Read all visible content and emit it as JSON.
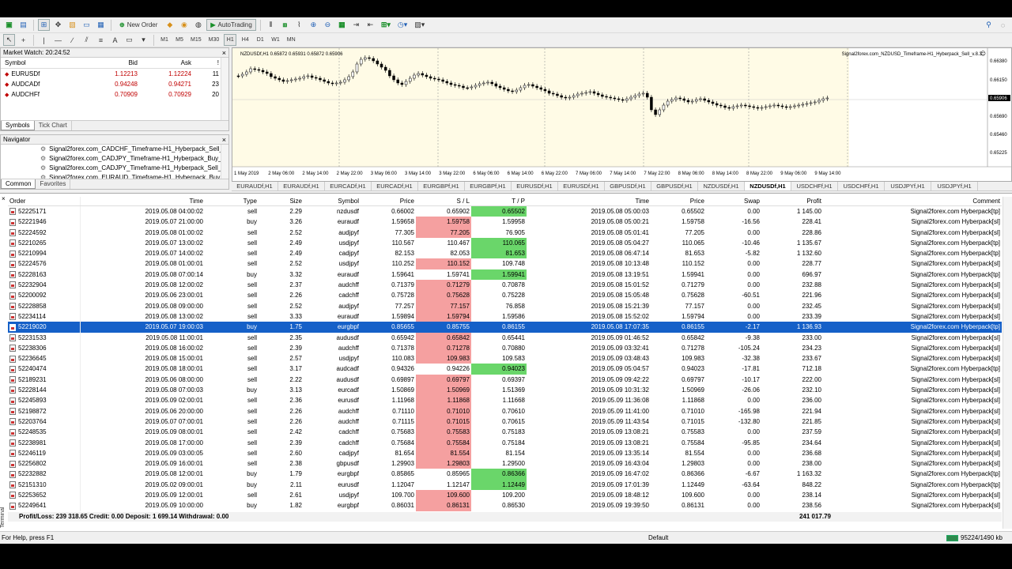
{
  "toolbar": {
    "new_order": "New Order",
    "autotrading": "AutoTrading",
    "timeframes": [
      "M1",
      "M5",
      "M15",
      "M30",
      "H1",
      "H4",
      "D1",
      "W1",
      "MN"
    ],
    "active_timeframe": "H1"
  },
  "market_watch": {
    "title": "Market Watch: 20:24:52",
    "columns": [
      "Symbol",
      "Bid",
      "Ask",
      "!"
    ],
    "rows": [
      {
        "symbol": "EURUSDf",
        "bid": "1.12213",
        "ask": "1.12224",
        "spread": "11"
      },
      {
        "symbol": "AUDCADf",
        "bid": "0.94248",
        "ask": "0.94271",
        "spread": "23"
      },
      {
        "symbol": "AUDCHFf",
        "bid": "0.70909",
        "ask": "0.70929",
        "spread": "20"
      }
    ],
    "tabs": [
      "Symbols",
      "Tick Chart"
    ]
  },
  "navigator": {
    "title": "Navigator",
    "items": [
      "Signal2forex.com_CADCHF_Timeframe-H1_Hyberpack_Sell_v.",
      "Signal2forex.com_CADJPY_Timeframe-H1_Hyberpack_Buy_v.",
      "Signal2forex.com_CADJPY_Timeframe-H1_Hyberpack_Sell_v.",
      "Signal2forex.com_EURAUD_Timeframe-H1_Hyberpack_Buy_v."
    ],
    "tabs": [
      "Common",
      "Favorites"
    ]
  },
  "chart": {
    "symbol_info": "NZDUSDf,H1  0.65872 0.65931 0.65872 0.65906",
    "ea_label": "Signal2forex.com_NZDUSD_Timeframe-H1_Hyberpack_Sell_v.8.3",
    "price_labels": [
      "0.66380",
      "0.66150",
      "0.65906",
      "0.65690",
      "0.65460",
      "0.65225"
    ],
    "current_price": "0.65906",
    "time_labels": [
      "1 May 2019",
      "2 May 06:00",
      "2 May 14:00",
      "2 May 22:00",
      "3 May 06:00",
      "3 May 14:00",
      "3 May 22:00",
      "6 May 06:00",
      "6 May 14:00",
      "6 May 22:00",
      "7 May 06:00",
      "7 May 14:00",
      "7 May 22:00",
      "8 May 06:00",
      "8 May 14:00",
      "8 May 22:00",
      "9 May 06:00",
      "9 May 14:00"
    ],
    "tabs": [
      "EURAUDf,H1",
      "EURAUDf,H1",
      "EURCADf,H1",
      "EURCADf,H1",
      "EURGBPf,H1",
      "EURGBPf,H1",
      "EURUSDf,H1",
      "EURUSDf,H1",
      "GBPUSDf,H1",
      "GBPUSDf,H1",
      "NZDUSDf,H1",
      "NZDUSDf,H1",
      "USDCHFf,H1",
      "USDCHFf,H1",
      "USDJPYf,H1",
      "USDJPYf,H1"
    ],
    "active_tab": 11
  },
  "terminal": {
    "label": "Terminal",
    "columns": [
      "Order",
      "Time",
      "Type",
      "Size",
      "Symbol",
      "Price",
      "S / L",
      "T / P",
      "Time",
      "Price",
      "Swap",
      "Profit",
      "Comment"
    ],
    "rows": [
      {
        "order": "52225171",
        "time": "2019.05.08 04:00:02",
        "type": "sell",
        "size": "2.29",
        "symbol": "nzdusdf",
        "price": "0.66002",
        "sl": "0.65902",
        "tp": "0.65502",
        "ctime": "2019.05.08 05:00:03",
        "cprice": "0.65502",
        "swap": "0.00",
        "profit": "1 145.00",
        "comment": "Signal2forex.com Hyberpack[tp]",
        "slc": "",
        "tpc": "g"
      },
      {
        "order": "52221946",
        "time": "2019.05.07 21:00:00",
        "type": "buy",
        "size": "3.26",
        "symbol": "euraudf",
        "price": "1.59658",
        "sl": "1.59758",
        "tp": "1.59958",
        "ctime": "2019.05.08 05:00:21",
        "cprice": "1.59758",
        "swap": "-16.56",
        "profit": "228.41",
        "comment": "Signal2forex.com Hyberpack[sl]",
        "slc": "r",
        "tpc": ""
      },
      {
        "order": "52224592",
        "time": "2019.05.08 01:00:02",
        "type": "sell",
        "size": "2.52",
        "symbol": "audjpyf",
        "price": "77.305",
        "sl": "77.205",
        "tp": "76.905",
        "ctime": "2019.05.08 05:01:41",
        "cprice": "77.205",
        "swap": "0.00",
        "profit": "228.86",
        "comment": "Signal2forex.com Hyberpack[sl]",
        "slc": "r",
        "tpc": ""
      },
      {
        "order": "52210265",
        "time": "2019.05.07 13:00:02",
        "type": "sell",
        "size": "2.49",
        "symbol": "usdjpyf",
        "price": "110.567",
        "sl": "110.467",
        "tp": "110.065",
        "ctime": "2019.05.08 05:04:27",
        "cprice": "110.065",
        "swap": "-10.46",
        "profit": "1 135.67",
        "comment": "Signal2forex.com Hyberpack[tp]",
        "slc": "",
        "tpc": "g"
      },
      {
        "order": "52210994",
        "time": "2019.05.07 14:00:02",
        "type": "sell",
        "size": "2.49",
        "symbol": "cadjpyf",
        "price": "82.153",
        "sl": "82.053",
        "tp": "81.653",
        "ctime": "2019.05.08 06:47:14",
        "cprice": "81.653",
        "swap": "-5.82",
        "profit": "1 132.60",
        "comment": "Signal2forex.com Hyberpack[tp]",
        "slc": "",
        "tpc": "g"
      },
      {
        "order": "52224576",
        "time": "2019.05.08 01:00:01",
        "type": "sell",
        "size": "2.52",
        "symbol": "usdjpyf",
        "price": "110.252",
        "sl": "110.152",
        "tp": "109.748",
        "ctime": "2019.05.08 10:13:48",
        "cprice": "110.152",
        "swap": "0.00",
        "profit": "228.77",
        "comment": "Signal2forex.com Hyberpack[sl]",
        "slc": "r",
        "tpc": ""
      },
      {
        "order": "52228163",
        "time": "2019.05.08 07:00:14",
        "type": "buy",
        "size": "3.32",
        "symbol": "euraudf",
        "price": "1.59641",
        "sl": "1.59741",
        "tp": "1.59941",
        "ctime": "2019.05.08 13:19:51",
        "cprice": "1.59941",
        "swap": "0.00",
        "profit": "696.97",
        "comment": "Signal2forex.com Hyberpack[tp]",
        "slc": "",
        "tpc": "g"
      },
      {
        "order": "52232904",
        "time": "2019.05.08 12:00:02",
        "type": "sell",
        "size": "2.37",
        "symbol": "audchff",
        "price": "0.71379",
        "sl": "0.71279",
        "tp": "0.70878",
        "ctime": "2019.05.08 15:01:52",
        "cprice": "0.71279",
        "swap": "0.00",
        "profit": "232.88",
        "comment": "Signal2forex.com Hyberpack[sl]",
        "slc": "r",
        "tpc": ""
      },
      {
        "order": "52200092",
        "time": "2019.05.06 23:00:01",
        "type": "sell",
        "size": "2.26",
        "symbol": "cadchff",
        "price": "0.75728",
        "sl": "0.75628",
        "tp": "0.75228",
        "ctime": "2019.05.08 15:05:48",
        "cprice": "0.75628",
        "swap": "-60.51",
        "profit": "221.96",
        "comment": "Signal2forex.com Hyberpack[sl]",
        "slc": "r",
        "tpc": ""
      },
      {
        "order": "52228858",
        "time": "2019.05.08 09:00:00",
        "type": "sell",
        "size": "2.52",
        "symbol": "audjpyf",
        "price": "77.257",
        "sl": "77.157",
        "tp": "76.858",
        "ctime": "2019.05.08 15:21:39",
        "cprice": "77.157",
        "swap": "0.00",
        "profit": "232.45",
        "comment": "Signal2forex.com Hyberpack[sl]",
        "slc": "r",
        "tpc": ""
      },
      {
        "order": "52234114",
        "time": "2019.05.08 13:00:02",
        "type": "sell",
        "size": "3.33",
        "symbol": "euraudf",
        "price": "1.59894",
        "sl": "1.59794",
        "tp": "1.59586",
        "ctime": "2019.05.08 15:52:02",
        "cprice": "1.59794",
        "swap": "0.00",
        "profit": "233.39",
        "comment": "Signal2forex.com Hyberpack[sl]",
        "slc": "r",
        "tpc": ""
      },
      {
        "order": "52219020",
        "time": "2019.05.07 19:00:03",
        "type": "buy",
        "size": "1.75",
        "symbol": "eurgbpf",
        "price": "0.85655",
        "sl": "0.85755",
        "tp": "0.86155",
        "ctime": "2019.05.08 17:07:35",
        "cprice": "0.86155",
        "swap": "-2.17",
        "profit": "1 136.93",
        "comment": "Signal2forex.com Hyberpack[tp]",
        "slc": "",
        "tpc": "",
        "sel": true
      },
      {
        "order": "52231533",
        "time": "2019.05.08 11:00:01",
        "type": "sell",
        "size": "2.35",
        "symbol": "audusdf",
        "price": "0.65942",
        "sl": "0.65842",
        "tp": "0.65441",
        "ctime": "2019.05.09 01:46:52",
        "cprice": "0.65842",
        "swap": "-9.38",
        "profit": "233.00",
        "comment": "Signal2forex.com Hyberpack[sl]",
        "slc": "r",
        "tpc": ""
      },
      {
        "order": "52238306",
        "time": "2019.05.08 16:00:02",
        "type": "sell",
        "size": "2.39",
        "symbol": "audchff",
        "price": "0.71378",
        "sl": "0.71278",
        "tp": "0.70880",
        "ctime": "2019.05.09 03:32:41",
        "cprice": "0.71278",
        "swap": "-105.24",
        "profit": "234.23",
        "comment": "Signal2forex.com Hyberpack[sl]",
        "slc": "r",
        "tpc": ""
      },
      {
        "order": "52236645",
        "time": "2019.05.08 15:00:01",
        "type": "sell",
        "size": "2.57",
        "symbol": "usdjpyf",
        "price": "110.083",
        "sl": "109.983",
        "tp": "109.583",
        "ctime": "2019.05.09 03:48:43",
        "cprice": "109.983",
        "swap": "-32.38",
        "profit": "233.67",
        "comment": "Signal2forex.com Hyberpack[sl]",
        "slc": "r",
        "tpc": ""
      },
      {
        "order": "52240474",
        "time": "2019.05.08 18:00:01",
        "type": "sell",
        "size": "3.17",
        "symbol": "audcadf",
        "price": "0.94326",
        "sl": "0.94226",
        "tp": "0.94023",
        "ctime": "2019.05.09 05:04:57",
        "cprice": "0.94023",
        "swap": "-17.81",
        "profit": "712.18",
        "comment": "Signal2forex.com Hyberpack[tp]",
        "slc": "",
        "tpc": "g"
      },
      {
        "order": "52189231",
        "time": "2019.05.06 08:00:00",
        "type": "sell",
        "size": "2.22",
        "symbol": "audusdf",
        "price": "0.69897",
        "sl": "0.69797",
        "tp": "0.69397",
        "ctime": "2019.05.09 09:42:22",
        "cprice": "0.69797",
        "swap": "-10.17",
        "profit": "222.00",
        "comment": "Signal2forex.com Hyberpack[sl]",
        "slc": "r",
        "tpc": ""
      },
      {
        "order": "52228144",
        "time": "2019.05.08 07:00:03",
        "type": "buy",
        "size": "3.13",
        "symbol": "eurcadf",
        "price": "1.50869",
        "sl": "1.50969",
        "tp": "1.51369",
        "ctime": "2019.05.09 10:31:32",
        "cprice": "1.50969",
        "swap": "-26.06",
        "profit": "232.10",
        "comment": "Signal2forex.com Hyberpack[sl]",
        "slc": "r",
        "tpc": ""
      },
      {
        "order": "52245893",
        "time": "2019.05.09 02:00:01",
        "type": "sell",
        "size": "2.36",
        "symbol": "eurusdf",
        "price": "1.11968",
        "sl": "1.11868",
        "tp": "1.11668",
        "ctime": "2019.05.09 11:36:08",
        "cprice": "1.11868",
        "swap": "0.00",
        "profit": "236.00",
        "comment": "Signal2forex.com Hyberpack[sl]",
        "slc": "r",
        "tpc": ""
      },
      {
        "order": "52198872",
        "time": "2019.05.06 20:00:00",
        "type": "sell",
        "size": "2.26",
        "symbol": "audchff",
        "price": "0.71110",
        "sl": "0.71010",
        "tp": "0.70610",
        "ctime": "2019.05.09 11:41:00",
        "cprice": "0.71010",
        "swap": "-165.98",
        "profit": "221.94",
        "comment": "Signal2forex.com Hyberpack[sl]",
        "slc": "r",
        "tpc": ""
      },
      {
        "order": "52203764",
        "time": "2019.05.07 07:00:01",
        "type": "sell",
        "size": "2.26",
        "symbol": "audchff",
        "price": "0.71115",
        "sl": "0.71015",
        "tp": "0.70615",
        "ctime": "2019.05.09 11:43:54",
        "cprice": "0.71015",
        "swap": "-132.80",
        "profit": "221.85",
        "comment": "Signal2forex.com Hyberpack[sl]",
        "slc": "r",
        "tpc": ""
      },
      {
        "order": "52248535",
        "time": "2019.05.09 08:00:01",
        "type": "sell",
        "size": "2.42",
        "symbol": "cadchff",
        "price": "0.75683",
        "sl": "0.75583",
        "tp": "0.75183",
        "ctime": "2019.05.09 13:08:21",
        "cprice": "0.75583",
        "swap": "0.00",
        "profit": "237.59",
        "comment": "Signal2forex.com Hyberpack[sl]",
        "slc": "r",
        "tpc": ""
      },
      {
        "order": "52238981",
        "time": "2019.05.08 17:00:00",
        "type": "sell",
        "size": "2.39",
        "symbol": "cadchff",
        "price": "0.75684",
        "sl": "0.75584",
        "tp": "0.75184",
        "ctime": "2019.05.09 13:08:21",
        "cprice": "0.75584",
        "swap": "-95.85",
        "profit": "234.64",
        "comment": "Signal2forex.com Hyberpack[sl]",
        "slc": "r",
        "tpc": ""
      },
      {
        "order": "52246119",
        "time": "2019.05.09 03:00:05",
        "type": "sell",
        "size": "2.60",
        "symbol": "cadjpyf",
        "price": "81.654",
        "sl": "81.554",
        "tp": "81.154",
        "ctime": "2019.05.09 13:35:14",
        "cprice": "81.554",
        "swap": "0.00",
        "profit": "236.68",
        "comment": "Signal2forex.com Hyberpack[sl]",
        "slc": "r",
        "tpc": ""
      },
      {
        "order": "52256802",
        "time": "2019.05.09 16:00:01",
        "type": "sell",
        "size": "2.38",
        "symbol": "gbpusdf",
        "price": "1.29903",
        "sl": "1.29803",
        "tp": "1.29500",
        "ctime": "2019.05.09 16:43:04",
        "cprice": "1.29803",
        "swap": "0.00",
        "profit": "238.00",
        "comment": "Signal2forex.com Hyberpack[sl]",
        "slc": "r",
        "tpc": ""
      },
      {
        "order": "52232882",
        "time": "2019.05.08 12:00:01",
        "type": "buy",
        "size": "1.79",
        "symbol": "eurgbpf",
        "price": "0.85865",
        "sl": "0.85965",
        "tp": "0.86366",
        "ctime": "2019.05.09 16:47:02",
        "cprice": "0.86366",
        "swap": "-6.67",
        "profit": "1 163.32",
        "comment": "Signal2forex.com Hyberpack[tp]",
        "slc": "",
        "tpc": "g"
      },
      {
        "order": "52151310",
        "time": "2019.05.02 09:00:01",
        "type": "buy",
        "size": "2.11",
        "symbol": "eurusdf",
        "price": "1.12047",
        "sl": "1.12147",
        "tp": "1.12449",
        "ctime": "2019.05.09 17:01:39",
        "cprice": "1.12449",
        "swap": "-63.64",
        "profit": "848.22",
        "comment": "Signal2forex.com Hyberpack[tp]",
        "slc": "",
        "tpc": "g"
      },
      {
        "order": "52253652",
        "time": "2019.05.09 12:00:01",
        "type": "sell",
        "size": "2.61",
        "symbol": "usdjpyf",
        "price": "109.700",
        "sl": "109.600",
        "tp": "109.200",
        "ctime": "2019.05.09 18:48:12",
        "cprice": "109.600",
        "swap": "0.00",
        "profit": "238.14",
        "comment": "Signal2forex.com Hyberpack[sl]",
        "slc": "r",
        "tpc": ""
      },
      {
        "order": "52249641",
        "time": "2019.05.09 10:00:00",
        "type": "buy",
        "size": "1.82",
        "symbol": "eurgbpf",
        "price": "0.86031",
        "sl": "0.86131",
        "tp": "0.86530",
        "ctime": "2019.05.09 19:39:50",
        "cprice": "0.86131",
        "swap": "0.00",
        "profit": "238.56",
        "comment": "Signal2forex.com Hyberpack[sl]",
        "slc": "r",
        "tpc": ""
      }
    ],
    "summary_left": "Profit/Loss: 239 318.65  Credit: 0.00  Deposit: 1 699.14  Withdrawal: 0.00",
    "summary_profit": "241 017.79",
    "tabs": [
      "Trade",
      "Exposure",
      "Account History",
      "News",
      "Alerts",
      "Mailbox",
      "Company",
      "Market",
      "Signals",
      "Articles",
      "Code Base",
      "Experts",
      "Journal"
    ],
    "mailbox_badge": "249",
    "active_tab": "Account History"
  },
  "status": {
    "help": "For Help, press F1",
    "profile": "Default",
    "traffic": "95224/1490 kb"
  }
}
